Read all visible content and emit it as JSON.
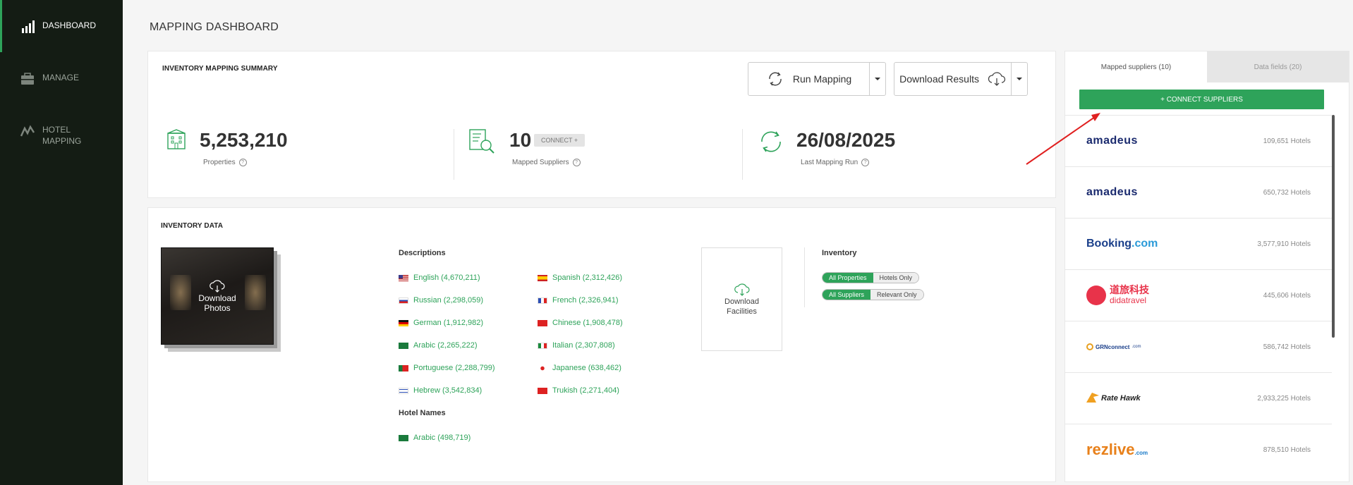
{
  "sidebar": {
    "items": [
      {
        "label": "DASHBOARD",
        "icon": "bar-chart-icon"
      },
      {
        "label": "MANAGE",
        "icon": "briefcase-icon"
      },
      {
        "label": "HOTEL MAPPING",
        "icon": "line-graph-icon"
      }
    ]
  },
  "page": {
    "title": "MAPPING DASHBOARD"
  },
  "summary": {
    "title": "INVENTORY MAPPING SUMMARY",
    "run_mapping": "Run Mapping",
    "download_results": "Download Results",
    "properties_value": "5,253,210",
    "properties_label": "Properties",
    "suppliers_value": "10",
    "suppliers_connect": "CONNECT +",
    "suppliers_label": "Mapped Suppliers",
    "last_run_value": "26/08/2025",
    "last_run_label": "Last Mapping Run",
    "help": "?"
  },
  "inventory": {
    "title": "INVENTORY DATA",
    "download_photos_line1": "Download",
    "download_photos_line2": "Photos",
    "descriptions_label": "Descriptions",
    "descriptions": [
      {
        "text": "English (4,670,211)",
        "flag": "us"
      },
      {
        "text": "Spanish (2,312,426)",
        "flag": "es"
      },
      {
        "text": "Russian (2,298,059)",
        "flag": "ru"
      },
      {
        "text": "French (2,326,941)",
        "flag": "fr"
      },
      {
        "text": "German (1,912,982)",
        "flag": "de"
      },
      {
        "text": "Chinese (1,908,478)",
        "flag": "cn"
      },
      {
        "text": "Arabic (2,265,222)",
        "flag": "sa"
      },
      {
        "text": "Italian (2,307,808)",
        "flag": "it"
      },
      {
        "text": "Portuguese (2,288,799)",
        "flag": "pt"
      },
      {
        "text": "Japanese (638,462)",
        "flag": "jp"
      },
      {
        "text": "Hebrew (3,542,834)",
        "flag": "il"
      },
      {
        "text": "Trukish (2,271,404)",
        "flag": "tr"
      }
    ],
    "hotel_names_label": "Hotel Names",
    "hotel_names": [
      {
        "text": "Arabic (498,719)",
        "flag": "sa"
      }
    ],
    "download_facilities_line1": "Download",
    "download_facilities_line2": "Facilities",
    "inventory_label": "Inventory",
    "toggle1_on": "All Properties",
    "toggle1_off": "Hotels Only",
    "toggle2_on": "All Suppliers",
    "toggle2_off": "Relevant Only"
  },
  "suppliers": {
    "tab_mapped": "Mapped suppliers (10)",
    "tab_fields": "Data fields (20)",
    "connect_button": "+ CONNECT SUPPLIERS",
    "list": [
      {
        "logo_text": "amadeus",
        "count": "109,651 Hotels"
      },
      {
        "logo_text": "amadeus",
        "count": "650,732 Hotels"
      },
      {
        "logo_text": "Booking",
        "logo_suffix": ".com",
        "count": "3,577,910 Hotels"
      },
      {
        "logo_text": "道旅科技",
        "logo_sub": "didatravel",
        "count": "445,606 Hotels"
      },
      {
        "logo_text": "GRNconnect",
        "logo_suffix": ".com",
        "count": "586,742 Hotels"
      },
      {
        "logo_text": "Rate Hawk",
        "count": "2,933,225 Hotels"
      },
      {
        "logo_text": "rezlive",
        "logo_suffix": ".com",
        "count": "878,510 Hotels"
      }
    ]
  },
  "colors": {
    "accent": "#2ea35a",
    "sidebar": "#141c14",
    "arrow": "#e02020"
  }
}
